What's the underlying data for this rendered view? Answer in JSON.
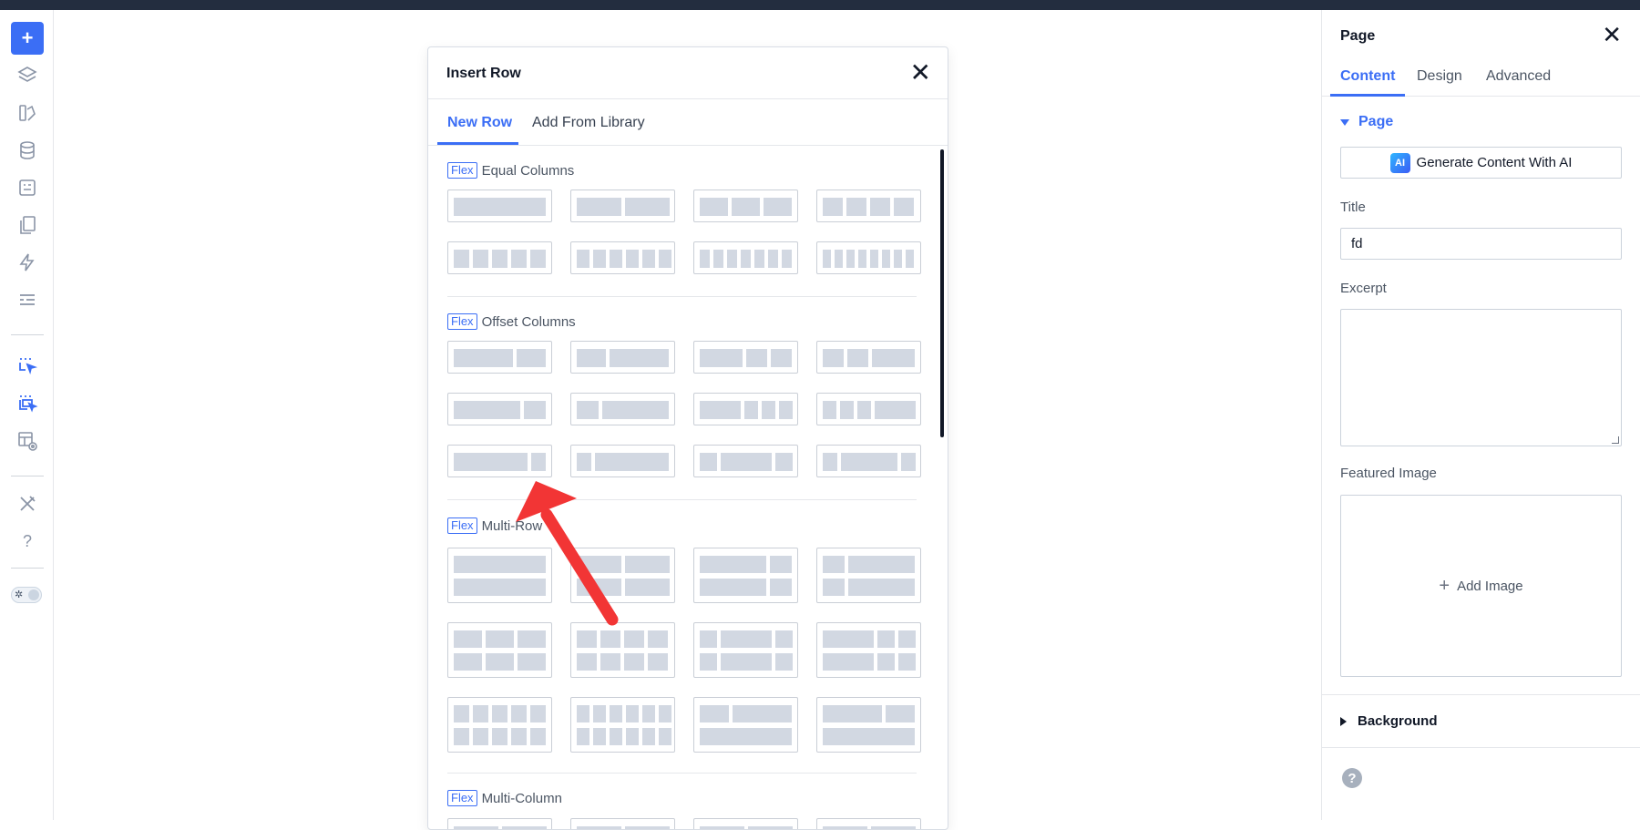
{
  "left_toolbar": {
    "add_label": "+",
    "help_label": "?"
  },
  "modal": {
    "title": "Insert Row",
    "close_label": "✕",
    "tabs": [
      {
        "label": "New Row",
        "active": true
      },
      {
        "label": "Add From Library",
        "active": false
      }
    ],
    "badge": "Flex",
    "sections": [
      {
        "name": "Equal Columns"
      },
      {
        "name": "Offset Columns"
      },
      {
        "name": "Multi-Row"
      },
      {
        "name": "Multi-Column"
      }
    ]
  },
  "annotation": {
    "arrow_color": "#f23535"
  },
  "right_panel": {
    "title": "Page",
    "close_label": "✕",
    "tabs": [
      {
        "label": "Content",
        "active": true
      },
      {
        "label": "Design",
        "active": false
      },
      {
        "label": "Advanced",
        "active": false
      }
    ],
    "section_page": "Page",
    "ai_icon": "AI",
    "ai_button": "Generate Content With AI",
    "title_label": "Title",
    "title_value": "fd",
    "excerpt_label": "Excerpt",
    "featured_label": "Featured Image",
    "add_image": "Add Image",
    "section_background": "Background"
  },
  "colors": {
    "accent": "#3b6ef5",
    "topbar": "#232d3f",
    "placeholder": "#d2d8e2"
  }
}
